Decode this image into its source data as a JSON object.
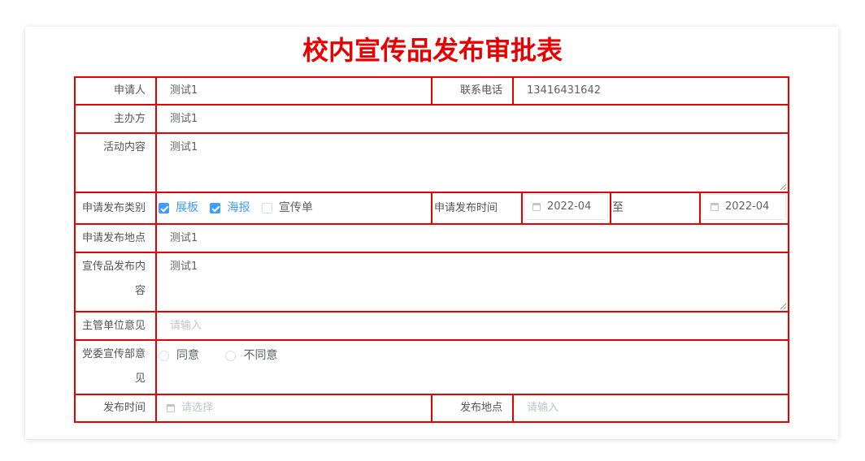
{
  "form": {
    "title": "校内宣传品发布审批表",
    "applicant_label": "申请人",
    "applicant_value": "测试1",
    "phone_label": "联系电话",
    "phone_value": "13416431642",
    "organizer_label": "主办方",
    "organizer_value": "测试1",
    "content_label": "活动内容",
    "content_value": "测试1",
    "category_label": "申请发布类别",
    "categories": [
      {
        "label": "展板",
        "checked": true
      },
      {
        "label": "海报",
        "checked": true
      },
      {
        "label": "宣传单",
        "checked": false
      }
    ],
    "time_label": "申请发布时间",
    "date_start": "2022-04",
    "date_sep": "至",
    "date_end": "2022-04",
    "location_label": "申请发布地点",
    "location_value": "测试1",
    "promo_content_label_1": "宣传品发布内",
    "promo_content_label_2": "容",
    "promo_content_value": "测试1",
    "supervisor_label": "主管单位意见",
    "supervisor_placeholder": "请输入",
    "party_label_1": "党委宣传部意",
    "party_label_2": "见",
    "party_options": [
      "同意",
      "不同意"
    ],
    "publish_time_label": "发布时间",
    "publish_time_placeholder": "请选择",
    "publish_place_label": "发布地点",
    "publish_place_placeholder": "请输入"
  },
  "colors": {
    "border": "#e60000",
    "title": "#e60000",
    "checked": "#409eff"
  }
}
